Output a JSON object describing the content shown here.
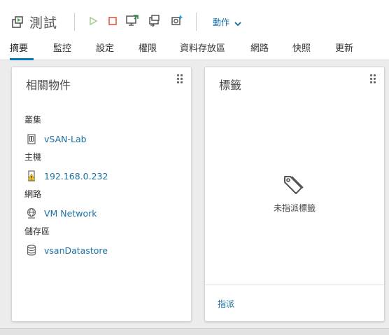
{
  "header": {
    "vm_name": "測試",
    "actions_label": "動作"
  },
  "toolbar_icons": [
    "power-on-icon",
    "power-off-icon",
    "launch-console-icon",
    "migrate-icon",
    "snapshot-icon"
  ],
  "tabs": [
    {
      "label": "摘要",
      "active": true
    },
    {
      "label": "監控",
      "active": false
    },
    {
      "label": "設定",
      "active": false
    },
    {
      "label": "權限",
      "active": false
    },
    {
      "label": "資料存放區",
      "active": false
    },
    {
      "label": "網路",
      "active": false
    },
    {
      "label": "快照",
      "active": false
    },
    {
      "label": "更新",
      "active": false
    }
  ],
  "related_objects": {
    "title": "相關物件",
    "sections": [
      {
        "label": "叢集",
        "item": "vSAN-Lab",
        "icon": "cluster-icon"
      },
      {
        "label": "主機",
        "item": "192.168.0.232",
        "icon": "host-warning-icon"
      },
      {
        "label": "網路",
        "item": "VM Network",
        "icon": "network-icon"
      },
      {
        "label": "儲存區",
        "item": "vsanDatastore",
        "icon": "datastore-icon"
      }
    ]
  },
  "tags": {
    "title": "標籤",
    "empty_text": "未指派標籤",
    "assign_label": "指派"
  },
  "colors": {
    "accent": "#0079b8",
    "link": "#1a6fa3",
    "power_on": "#a3c98a",
    "power_off": "#e0593b",
    "warning": "#f5c518"
  }
}
